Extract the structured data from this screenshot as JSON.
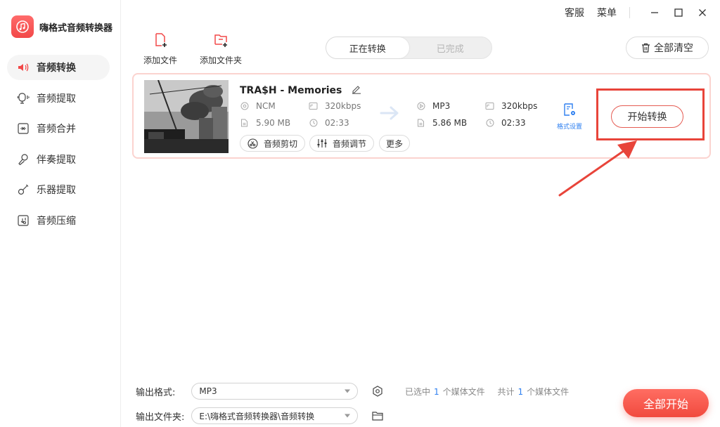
{
  "app": {
    "name": "嗨格式音频转换器",
    "accent": "#f24848",
    "link_color": "#2d7ff0"
  },
  "titlebar": {
    "service": "客服",
    "menu": "菜单"
  },
  "sidebar": {
    "items": [
      {
        "label": "音频转换",
        "icon": "speaker-convert-icon",
        "active": true
      },
      {
        "label": "音频提取",
        "icon": "video-extract-icon"
      },
      {
        "label": "音频合并",
        "icon": "merge-icon"
      },
      {
        "label": "伴奏提取",
        "icon": "microphone-icon"
      },
      {
        "label": "乐器提取",
        "icon": "guitar-icon"
      },
      {
        "label": "音频压缩",
        "icon": "compress-icon"
      }
    ]
  },
  "toolbar": {
    "add_file": "添加文件",
    "add_folder": "添加文件夹",
    "clear_all": "全部清空"
  },
  "tabs": [
    {
      "label": "正在转换",
      "active": true
    },
    {
      "label": "已完成"
    }
  ],
  "file": {
    "title": "TRA$H - Memories",
    "source": {
      "format": "NCM",
      "bitrate": "320kbps",
      "size": "5.90 MB",
      "duration": "02:33"
    },
    "target": {
      "format": "MP3",
      "bitrate": "320kbps",
      "size": "5.86 MB",
      "duration": "02:33"
    },
    "actions": {
      "cut": "音频剪切",
      "adjust": "音频调节",
      "more": "更多"
    },
    "format_settings": "格式设置",
    "start": "开始转换"
  },
  "bottom": {
    "output_format_label": "输出格式:",
    "output_format_value": "MP3",
    "output_folder_label": "输出文件夹:",
    "output_folder_value": "E:\\嗨格式音频转换器\\音频转换",
    "selected_prefix": "已选中",
    "selected_count": "1",
    "selected_suffix": "个媒体文件",
    "total_prefix": "共计",
    "total_count": "1",
    "total_suffix": "个媒体文件",
    "start_all": "全部开始"
  }
}
